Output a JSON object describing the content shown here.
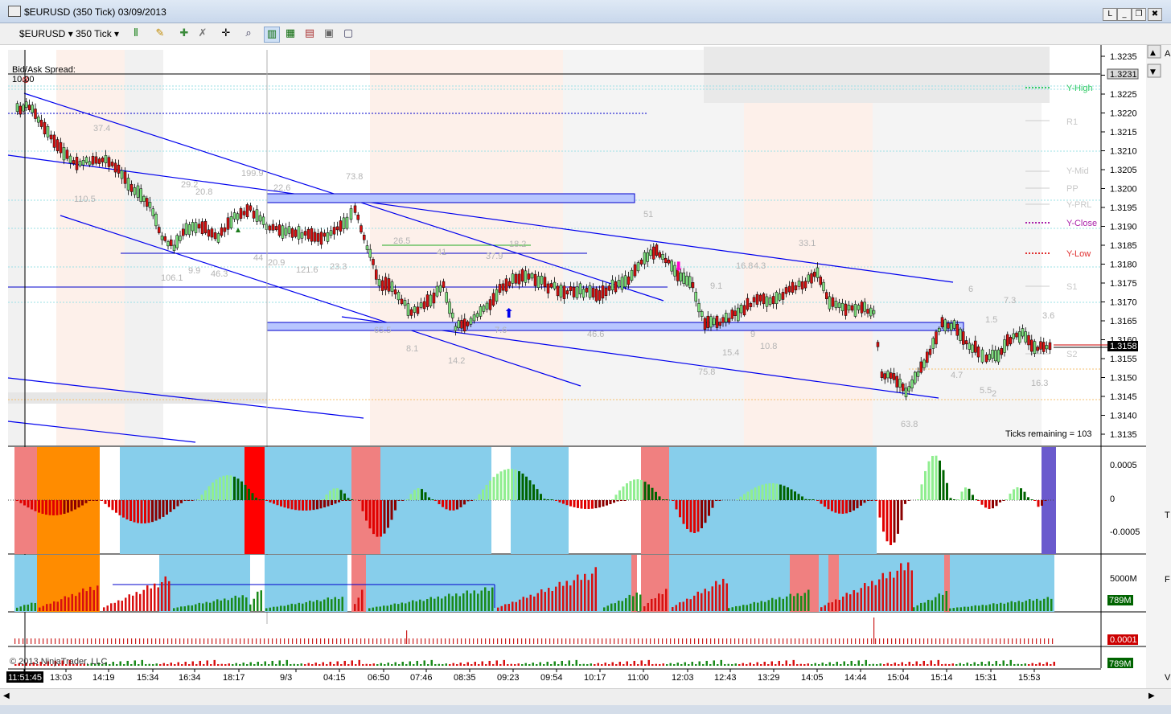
{
  "window": {
    "title": "$EURUSD (350 Tick)  03/09/2013",
    "buttons": [
      "L",
      "_",
      "❐",
      "✖"
    ]
  },
  "toolbar": {
    "instrument": "$EURUSD",
    "interval": "350 Tick",
    "icons": [
      "bars-type-icon",
      "pencil-icon",
      "pin-icon",
      "crosshair-icon",
      "zoom-icon",
      "chart-props-icon",
      "indicators-icon",
      "strategies-icon",
      "data-box-icon",
      "templates-icon"
    ]
  },
  "price_axis": {
    "labels": [
      "1.3235",
      "1.3230",
      "1.3225",
      "1.3220",
      "1.3215",
      "1.3210",
      "1.3205",
      "1.3200",
      "1.3195",
      "1.3190",
      "1.3185",
      "1.3180",
      "1.3175",
      "1.3170",
      "1.3165",
      "1.3160",
      "1.3155",
      "1.3150",
      "1.3145",
      "1.3140",
      "1.3135"
    ],
    "current_price": "1.3158",
    "marker_price": "1.3231"
  },
  "pivots": [
    "Y-High",
    "R1",
    "Y-Mid",
    "PP",
    "Y-PRL",
    "Y-Close",
    "Y-Low",
    "S1",
    "S2"
  ],
  "pivot_colors": {
    "Y-High": "#33cc66",
    "Y-Close": "#aa22aa",
    "Y-Low": "#e03030",
    "other": "#c8c8c8"
  },
  "bid_ask": {
    "label": "Bid/Ask Spread:",
    "value": "10.00"
  },
  "ticks_remaining": "Ticks remaining = 103",
  "volume_labels": [
    "37.4",
    "110.5",
    "29.2",
    "20.8",
    "199.9",
    "22.6",
    "73.8",
    "44",
    "20.9",
    "121.6",
    "23.3",
    "106.1",
    "9.9",
    "46.3",
    "26.5",
    "41",
    "37.9",
    "18.2",
    "51",
    "65.5",
    "8.1",
    "14.2",
    "7.6",
    "46.6",
    "33.1",
    "4.3",
    "16.8",
    "9.1",
    "15.4",
    "9",
    "10.8",
    "75.8",
    "6",
    "7.3",
    "1.5",
    "3.6",
    "4.7",
    "5.5",
    "2",
    "16.3",
    "63.8"
  ],
  "osc_axis": [
    "0.0005",
    "0",
    "-0.0005"
  ],
  "vol_axis": {
    "label": "5000M",
    "value": "789M"
  },
  "panel3_value": "0.0001",
  "panel4_value": "789M",
  "copyright": "© 2013 NinjaTrader, LLC",
  "time_axis": [
    "11:51:45",
    "13:03",
    "14:19",
    "15:34",
    "16:34",
    "18:17",
    "9/3",
    "04:15",
    "06:50",
    "07:46",
    "08:35",
    "09:23",
    "09:54",
    "10:17",
    "11:00",
    "12:03",
    "12:43",
    "13:29",
    "14:05",
    "14:44",
    "15:04",
    "15:14",
    "15:31",
    "15:53"
  ],
  "right_edge_letters": [
    "A",
    "T",
    "F",
    "V"
  ]
}
